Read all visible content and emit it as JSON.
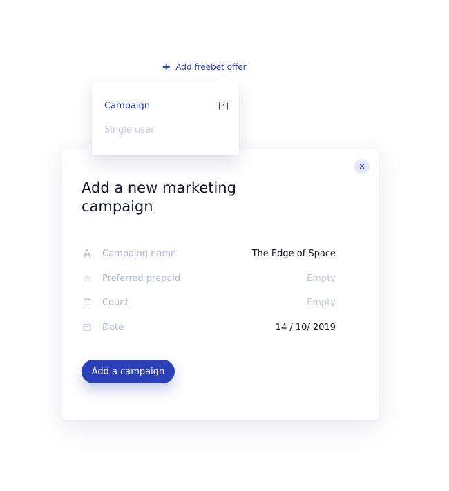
{
  "offer_link": {
    "icon": "plus-icon",
    "label": "Add freebet offer"
  },
  "dropdown": {
    "options": [
      {
        "label": "Campaign",
        "selected": true
      },
      {
        "label": "Single user",
        "selected": false
      }
    ]
  },
  "modal": {
    "title": "Add a new marketing campaign",
    "fields": [
      {
        "icon": "letter-a-icon",
        "label": "Campaing name",
        "value": "The Edge of Space"
      },
      {
        "icon": "star-icon",
        "label": "Preferred prepaid",
        "value": "Empty"
      },
      {
        "icon": "list-icon",
        "label": "Count",
        "value": "Empty"
      },
      {
        "icon": "calendar-icon",
        "label": "Date",
        "value": "14 / 10/ 2019"
      }
    ],
    "submit_label": "Add a campaign"
  },
  "colors": {
    "accent": "#2a3fb8",
    "muted": "#b3b8d6"
  }
}
